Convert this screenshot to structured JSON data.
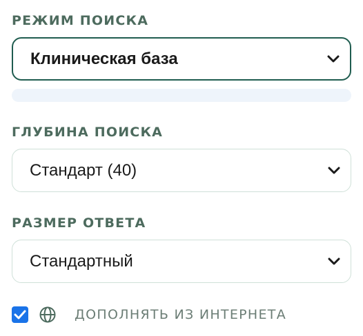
{
  "search_mode": {
    "label": "РЕЖИМ ПОИСКА",
    "selected": "Клиническая база",
    "icon": "chevron-down-icon"
  },
  "progress": {
    "value": 0
  },
  "search_depth": {
    "label": "ГЛУБИНА ПОИСКА",
    "selected": "Стандарт (40)",
    "icon": "chevron-down-icon"
  },
  "answer_size": {
    "label": "РАЗМЕР ОТВЕТА",
    "selected": "Стандартный",
    "icon": "chevron-down-icon"
  },
  "internet": {
    "checked": true,
    "icon": "globe-icon",
    "label": "ДОПОЛНЯТЬ ИЗ ИНТЕРНЕТА"
  },
  "colors": {
    "label_text": "#4d6b5e",
    "active_border": "#1f5c4f",
    "idle_border": "#cfe0d8",
    "checkbox": "#1a73e8",
    "progress_track": "#eef4fb"
  }
}
